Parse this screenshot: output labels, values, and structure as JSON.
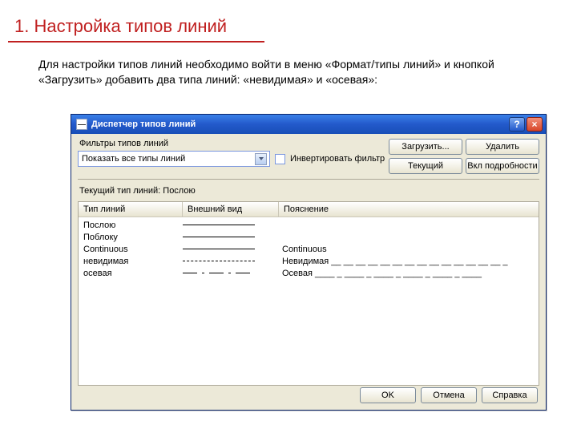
{
  "slide": {
    "title": "1. Настройка типов линий",
    "description": "Для настройки типов линий необходимо войти в меню «Формат/типы линий» и кнопкой «Загрузить» добавить два типа линий: «невидимая» и «осевая»:"
  },
  "window": {
    "title": "Диспетчер типов линий",
    "help_symbol": "?",
    "close_symbol": "×"
  },
  "filter": {
    "label": "Фильтры типов линий",
    "combo_value": "Показать все типы линий",
    "invert_label": "Инвертировать фильтр"
  },
  "buttons": {
    "load": "Загрузить...",
    "delete": "Удалить",
    "current": "Текущий",
    "details": "Вкл подробности",
    "ok": "OK",
    "cancel": "Отмена",
    "help": "Справка"
  },
  "current_line": "Текущий тип линий: Послою",
  "headers": {
    "name": "Тип линий",
    "look": "Внешний вид",
    "desc": "Пояснение"
  },
  "rows": {
    "r0": {
      "name": "Послою",
      "desc": ""
    },
    "r1": {
      "name": "Поблоку",
      "desc": ""
    },
    "r2": {
      "name": "Continuous",
      "desc": "Continuous"
    },
    "r3": {
      "name": "невидимая",
      "desc": "Невидимая __ __ __ __ __ __ __ __ __ __ __ __ __ __ _"
    },
    "r4": {
      "name": "осевая",
      "desc": "Осевая ____ _ ____ _ ____ _ ____ _ ____ _ ____"
    }
  }
}
